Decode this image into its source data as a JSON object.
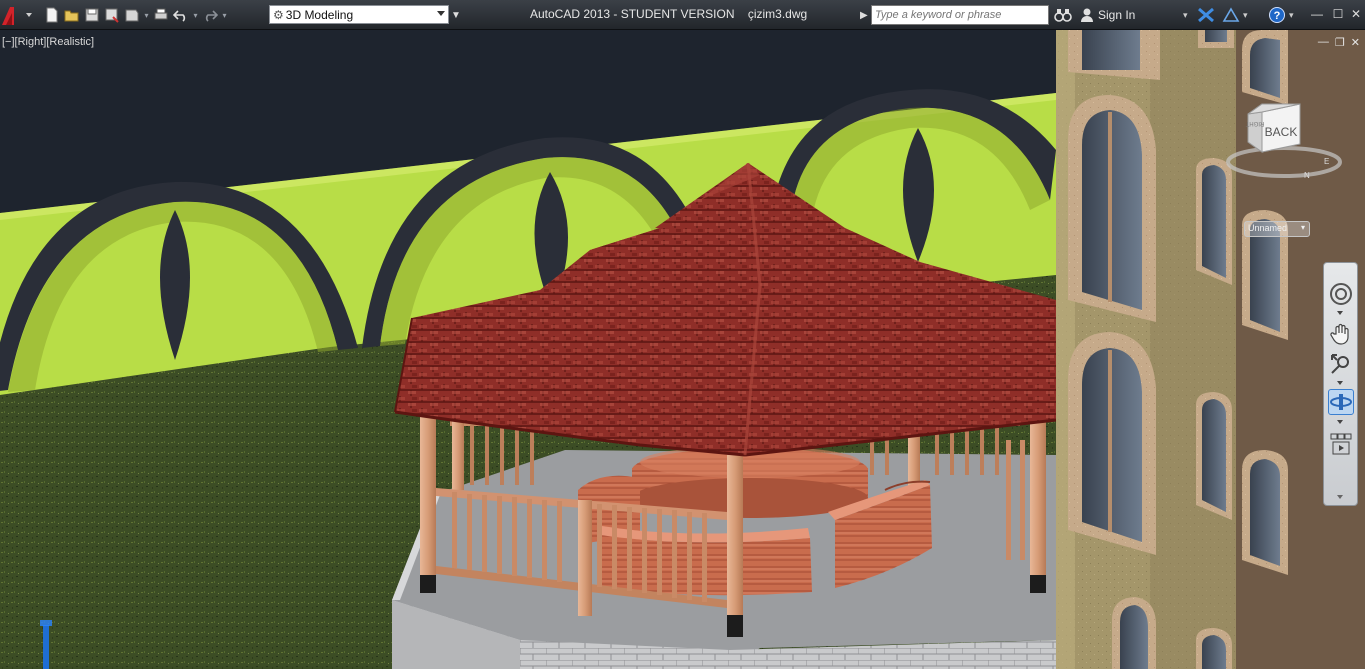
{
  "title_bar": {
    "app_title": "AutoCAD 2013 - STUDENT VERSION    çizim3.dwg",
    "workspace": "3D Modeling",
    "search_placeholder": "Type a keyword or phrase",
    "sign_in": "Sign In"
  },
  "viewport": {
    "label": "[−][Right][Realistic]"
  },
  "viewcube": {
    "face": "BACK",
    "compass_n": "N",
    "compass_e": "E"
  },
  "ucs": {
    "selected": "Unnamed"
  },
  "colors": {
    "title_bar": "#2d3137",
    "viewport_bg": "#1e242e",
    "wall": "#b9de48",
    "wall_arch": "#2a2e38",
    "ground": "#3f5026",
    "roof": "#8e2f29",
    "wood": "#d9a27a",
    "floor": "#9b9da0",
    "building": "#9c8e62",
    "accent_blue": "#1b6ad0"
  }
}
